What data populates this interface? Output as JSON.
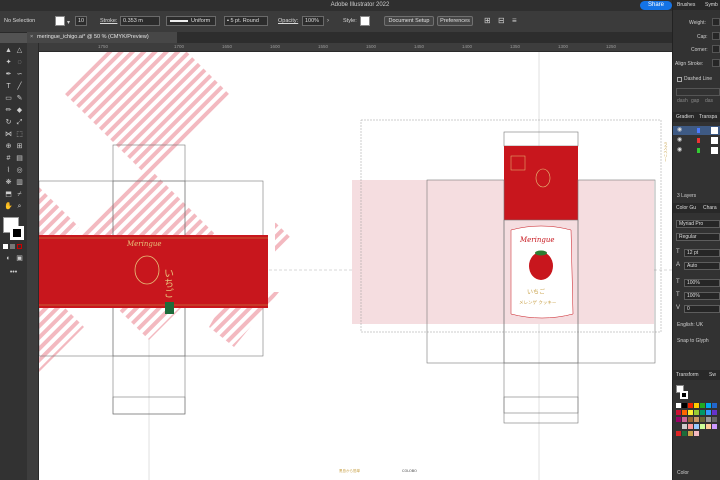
{
  "app": {
    "window_title": "Adobe Illustrator 2022",
    "share_label": "Share"
  },
  "control_bar": {
    "selection_label": "No Selection",
    "stroke_label": "Stroke:",
    "stroke_weight": "0.353 m",
    "stroke_profile": "Uniform",
    "brush_value": "5 pt. Round",
    "opacity_label": "Opacity:",
    "opacity_value": "100%",
    "style_label": "Style:",
    "document_setup_label": "Document Setup",
    "preferences_label": "Preferences",
    "stroke_swatch_value": "10"
  },
  "document": {
    "tab_title": "meringue_ichigo.ai* @ 50 % (CMYK/Preview)",
    "close_glyph": "×"
  },
  "rulers": {
    "top_labels": [
      "1750",
      "1700",
      "1650",
      "1600",
      "1550",
      "1500",
      "1450",
      "1400",
      "1350",
      "1300",
      "1250"
    ]
  },
  "artwork": {
    "brand_script": "Meringue",
    "product_jp": "いちご",
    "product_jp_sub": "メレンゲ\nクッキー",
    "side_text": "ラズベリー",
    "footer_text_left": "黒島から簡単",
    "footer_text_right": "COLOBO"
  },
  "panels": {
    "top_tabs": [
      "Brushes",
      "Symb"
    ],
    "stroke": {
      "weight_label": "Weight:",
      "cap_label": "Cap:",
      "corner_label": "Corner:",
      "align_label": "Align Stroke:",
      "dashed_label": "Dashed Line",
      "dash_labels": [
        "dash",
        "gap",
        "das"
      ]
    },
    "gradient_tabs": [
      "Gradien",
      "Transpa"
    ],
    "layers_count": "3 Layers",
    "char_tabs": [
      "Color Gu",
      "Chara"
    ],
    "character": {
      "font_family": "Myriad Pro",
      "font_style": "Regular",
      "font_size": "12 pt",
      "leading": "Auto",
      "h_scale": "100%",
      "v_scale": "100%",
      "tracking_value": "0",
      "language": "English: UK",
      "snap_label": "Snap to Glyph"
    },
    "transform_tabs": [
      "Transform",
      "Sw"
    ],
    "color_tab": "Color"
  },
  "colors": {
    "accent_red": "#c8161d",
    "stripe_pink": "#f3b9c0",
    "light_pink": "#f5dde0",
    "gold": "#c9a24a",
    "green_badge": "#1d6b3a"
  }
}
